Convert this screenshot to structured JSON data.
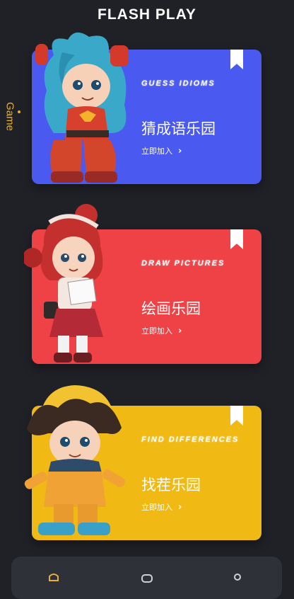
{
  "app": {
    "title": "FLASH PLAY"
  },
  "side_tab": {
    "label": "Game"
  },
  "cards": [
    {
      "en": "GUESS IDIOMS",
      "cn": "猜成语乐园",
      "join": "立即加入",
      "color": "#4a5af0"
    },
    {
      "en": "DRAW PICTURES",
      "cn": "绘画乐园",
      "join": "立即加入",
      "color": "#ee4246"
    },
    {
      "en": "FIND DIFFERENCES",
      "cn": "找茬乐园",
      "join": "立即加入",
      "color": "#f0b914"
    }
  ],
  "icons": {
    "bookmark": "bookmark-icon",
    "chevron": "chevron-right-icon",
    "nav": [
      "game-controller-icon",
      "chat-icon",
      "profile-icon"
    ]
  }
}
